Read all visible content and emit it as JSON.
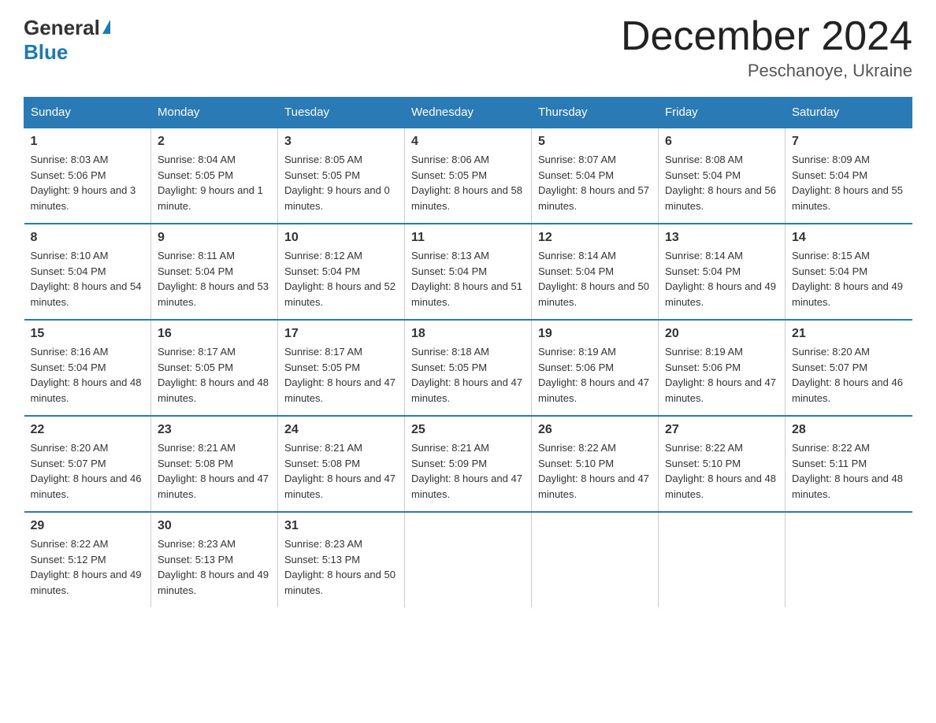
{
  "logo": {
    "general": "General",
    "blue": "Blue"
  },
  "header": {
    "month_year": "December 2024",
    "location": "Peschanoye, Ukraine"
  },
  "weekdays": [
    "Sunday",
    "Monday",
    "Tuesday",
    "Wednesday",
    "Thursday",
    "Friday",
    "Saturday"
  ],
  "weeks": [
    [
      {
        "day": "1",
        "sunrise": "8:03 AM",
        "sunset": "5:06 PM",
        "daylight": "9 hours and 3 minutes."
      },
      {
        "day": "2",
        "sunrise": "8:04 AM",
        "sunset": "5:05 PM",
        "daylight": "9 hours and 1 minute."
      },
      {
        "day": "3",
        "sunrise": "8:05 AM",
        "sunset": "5:05 PM",
        "daylight": "9 hours and 0 minutes."
      },
      {
        "day": "4",
        "sunrise": "8:06 AM",
        "sunset": "5:05 PM",
        "daylight": "8 hours and 58 minutes."
      },
      {
        "day": "5",
        "sunrise": "8:07 AM",
        "sunset": "5:04 PM",
        "daylight": "8 hours and 57 minutes."
      },
      {
        "day": "6",
        "sunrise": "8:08 AM",
        "sunset": "5:04 PM",
        "daylight": "8 hours and 56 minutes."
      },
      {
        "day": "7",
        "sunrise": "8:09 AM",
        "sunset": "5:04 PM",
        "daylight": "8 hours and 55 minutes."
      }
    ],
    [
      {
        "day": "8",
        "sunrise": "8:10 AM",
        "sunset": "5:04 PM",
        "daylight": "8 hours and 54 minutes."
      },
      {
        "day": "9",
        "sunrise": "8:11 AM",
        "sunset": "5:04 PM",
        "daylight": "8 hours and 53 minutes."
      },
      {
        "day": "10",
        "sunrise": "8:12 AM",
        "sunset": "5:04 PM",
        "daylight": "8 hours and 52 minutes."
      },
      {
        "day": "11",
        "sunrise": "8:13 AM",
        "sunset": "5:04 PM",
        "daylight": "8 hours and 51 minutes."
      },
      {
        "day": "12",
        "sunrise": "8:14 AM",
        "sunset": "5:04 PM",
        "daylight": "8 hours and 50 minutes."
      },
      {
        "day": "13",
        "sunrise": "8:14 AM",
        "sunset": "5:04 PM",
        "daylight": "8 hours and 49 minutes."
      },
      {
        "day": "14",
        "sunrise": "8:15 AM",
        "sunset": "5:04 PM",
        "daylight": "8 hours and 49 minutes."
      }
    ],
    [
      {
        "day": "15",
        "sunrise": "8:16 AM",
        "sunset": "5:04 PM",
        "daylight": "8 hours and 48 minutes."
      },
      {
        "day": "16",
        "sunrise": "8:17 AM",
        "sunset": "5:05 PM",
        "daylight": "8 hours and 48 minutes."
      },
      {
        "day": "17",
        "sunrise": "8:17 AM",
        "sunset": "5:05 PM",
        "daylight": "8 hours and 47 minutes."
      },
      {
        "day": "18",
        "sunrise": "8:18 AM",
        "sunset": "5:05 PM",
        "daylight": "8 hours and 47 minutes."
      },
      {
        "day": "19",
        "sunrise": "8:19 AM",
        "sunset": "5:06 PM",
        "daylight": "8 hours and 47 minutes."
      },
      {
        "day": "20",
        "sunrise": "8:19 AM",
        "sunset": "5:06 PM",
        "daylight": "8 hours and 47 minutes."
      },
      {
        "day": "21",
        "sunrise": "8:20 AM",
        "sunset": "5:07 PM",
        "daylight": "8 hours and 46 minutes."
      }
    ],
    [
      {
        "day": "22",
        "sunrise": "8:20 AM",
        "sunset": "5:07 PM",
        "daylight": "8 hours and 46 minutes."
      },
      {
        "day": "23",
        "sunrise": "8:21 AM",
        "sunset": "5:08 PM",
        "daylight": "8 hours and 47 minutes."
      },
      {
        "day": "24",
        "sunrise": "8:21 AM",
        "sunset": "5:08 PM",
        "daylight": "8 hours and 47 minutes."
      },
      {
        "day": "25",
        "sunrise": "8:21 AM",
        "sunset": "5:09 PM",
        "daylight": "8 hours and 47 minutes."
      },
      {
        "day": "26",
        "sunrise": "8:22 AM",
        "sunset": "5:10 PM",
        "daylight": "8 hours and 47 minutes."
      },
      {
        "day": "27",
        "sunrise": "8:22 AM",
        "sunset": "5:10 PM",
        "daylight": "8 hours and 48 minutes."
      },
      {
        "day": "28",
        "sunrise": "8:22 AM",
        "sunset": "5:11 PM",
        "daylight": "8 hours and 48 minutes."
      }
    ],
    [
      {
        "day": "29",
        "sunrise": "8:22 AM",
        "sunset": "5:12 PM",
        "daylight": "8 hours and 49 minutes."
      },
      {
        "day": "30",
        "sunrise": "8:23 AM",
        "sunset": "5:13 PM",
        "daylight": "8 hours and 49 minutes."
      },
      {
        "day": "31",
        "sunrise": "8:23 AM",
        "sunset": "5:13 PM",
        "daylight": "8 hours and 50 minutes."
      },
      null,
      null,
      null,
      null
    ]
  ]
}
